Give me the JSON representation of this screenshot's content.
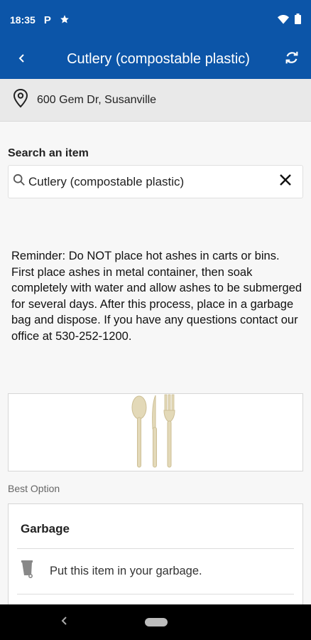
{
  "status_bar": {
    "time": "18:35",
    "icons": [
      "parking-icon",
      "star-icon",
      "wifi-icon",
      "battery-icon"
    ]
  },
  "app_bar": {
    "title": "Cutlery (compostable plastic)",
    "back_icon": "back-arrow-icon",
    "refresh_icon": "refresh-icon"
  },
  "address": {
    "text": "600 Gem Dr, Susanville",
    "icon": "location-pin-icon"
  },
  "search": {
    "label": "Search an item",
    "value": "Cutlery (compostable plastic)",
    "placeholder": ""
  },
  "reminder": {
    "text": "Reminder: Do NOT place hot ashes in carts or bins. First place ashes in metal container, then soak completely with water and allow ashes to be submerged for several days. After this process, place in a garbage bag and dispose. If you have any questions contact our office at 530-252-1200."
  },
  "best_option_label": "Best Option",
  "disposal": {
    "title": "Garbage",
    "instruction": "Put this item in your garbage.",
    "icon": "garbage-bin-icon"
  },
  "colors": {
    "primary": "#0c55a8",
    "address_bg": "#e9e9e9",
    "page_bg": "#f7f7f7"
  }
}
